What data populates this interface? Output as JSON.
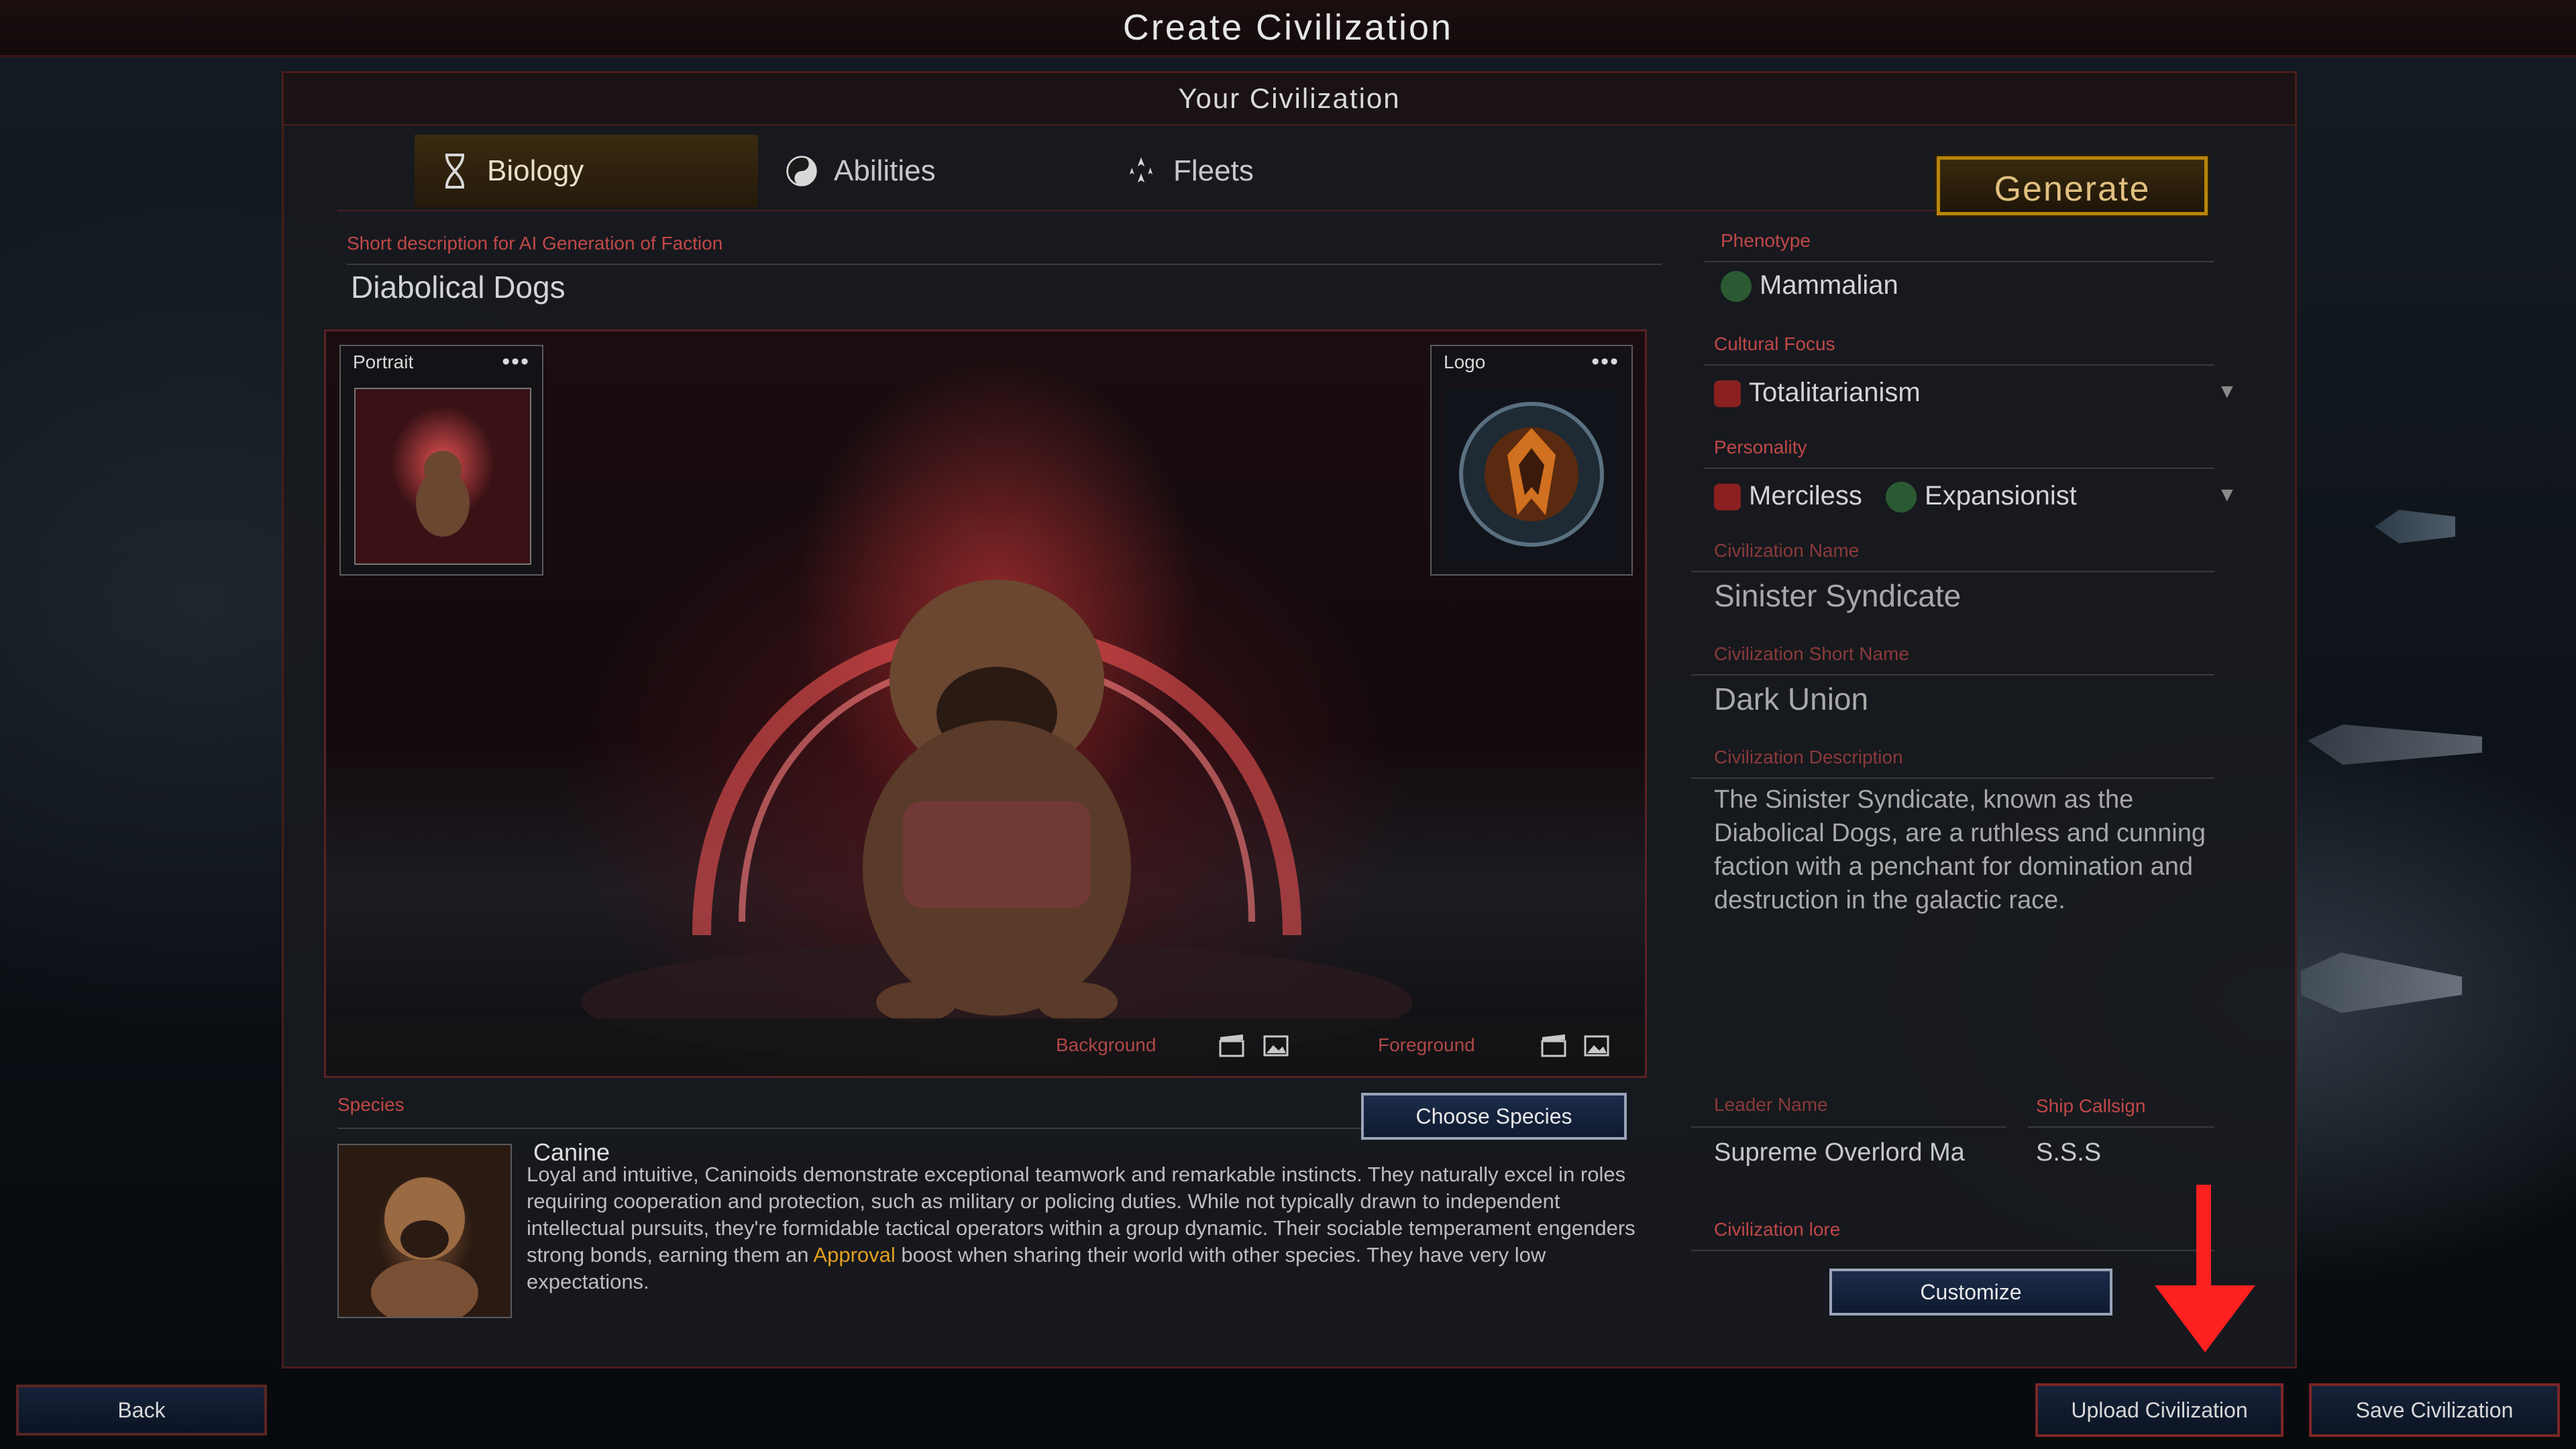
{
  "window": {
    "title": "Create Civilization"
  },
  "panel": {
    "header": "Your Civilization"
  },
  "tabs": [
    {
      "label": "Biology",
      "icon": "dna-icon",
      "active": true
    },
    {
      "label": "Abilities",
      "icon": "yin-yang-icon",
      "active": false
    },
    {
      "label": "Fleets",
      "icon": "fleet-icon",
      "active": false
    }
  ],
  "generate_label": "Generate",
  "faction": {
    "label": "Short description for AI Generation of Faction",
    "value": "Diabolical Dogs"
  },
  "portrait": {
    "label": "Portrait",
    "menu": "•••"
  },
  "logo": {
    "label": "Logo",
    "menu": "•••"
  },
  "image_bar": {
    "background_label": "Background",
    "foreground_label": "Foreground"
  },
  "species": {
    "label": "Species",
    "choose_label": "Choose Species",
    "name": "Canine",
    "description_before": "Loyal and intuitive, Caninoids demonstrate exceptional teamwork and remarkable instincts. They naturally excel in roles requiring cooperation and protection, such as military or policing duties. While not typically drawn to independent intellectual pursuits, they're formidable tactical operators within a group dynamic. Their sociable temperament engenders strong bonds, earning them an ",
    "highlight": "Approval",
    "description_after": " boost when sharing their world with other species. They have very low expectations."
  },
  "phenotype": {
    "label": "Phenotype",
    "value": "Mammalian"
  },
  "cultural_focus": {
    "label": "Cultural Focus",
    "value": "Totalitarianism"
  },
  "personality": {
    "label": "Personality",
    "value1": "Merciless",
    "value2": "Expansionist"
  },
  "civ_name": {
    "label": "Civilization Name",
    "value": "Sinister Syndicate"
  },
  "civ_short": {
    "label": "Civilization Short Name",
    "value": "Dark Union"
  },
  "civ_desc": {
    "label": "Civilization Description",
    "value": "The Sinister Syndicate, known as the Diabolical Dogs, are a ruthless and cunning faction with a penchant for domination and destruction in the galactic race."
  },
  "leader": {
    "label": "Leader Name",
    "value": "Supreme Overlord Ma"
  },
  "callsign": {
    "label": "Ship Callsign",
    "value": "S.S.S"
  },
  "lore": {
    "label": "Civilization lore",
    "button": "Customize"
  },
  "footer": {
    "back": "Back",
    "upload": "Upload Civilization",
    "save": "Save Civilization"
  },
  "colors": {
    "accent_red": "#c04848",
    "gold": "#b8860b",
    "annotation_arrow": "#ff2020"
  }
}
